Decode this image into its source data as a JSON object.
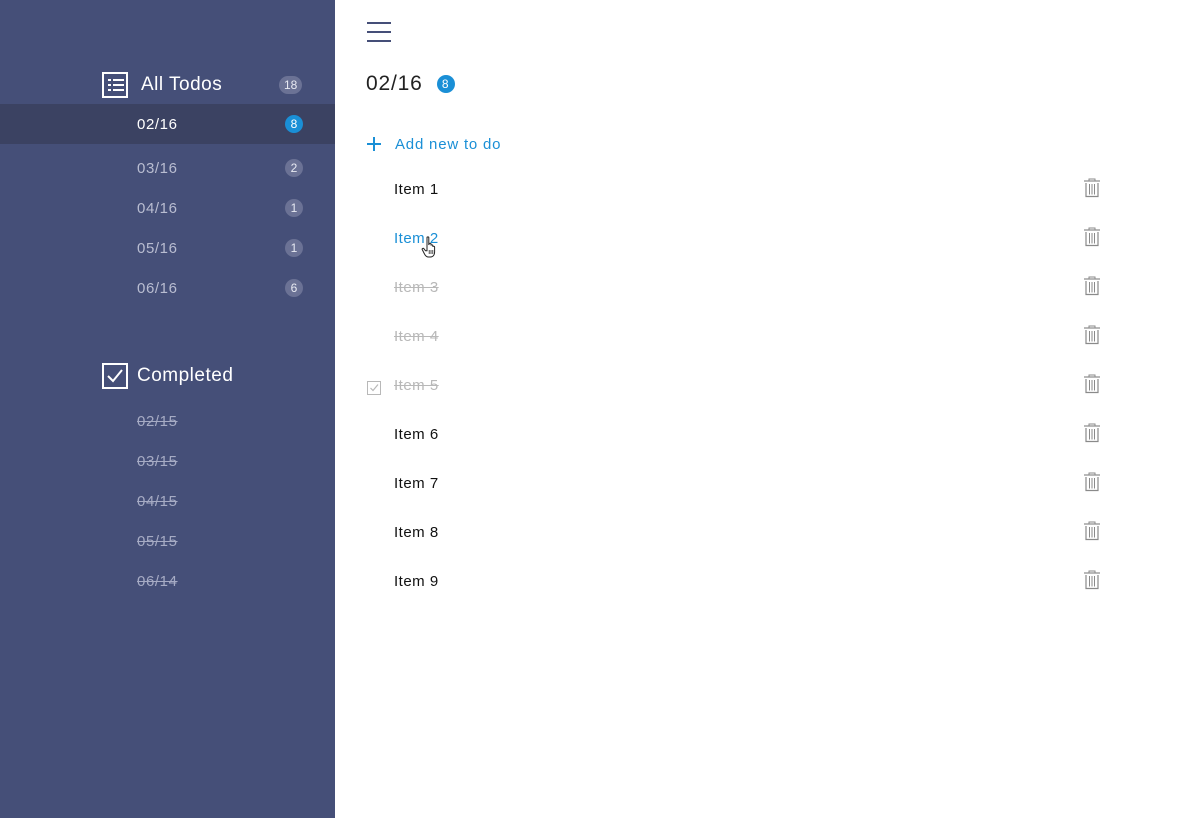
{
  "sidebar": {
    "todos_header": {
      "label": "All Todos",
      "count": "18",
      "icon": "list-icon"
    },
    "todo_dates": [
      {
        "date": "02/16",
        "count": "8",
        "selected": true
      },
      {
        "date": "03/16",
        "count": "2"
      },
      {
        "date": "04/16",
        "count": "1"
      },
      {
        "date": "05/16",
        "count": "1"
      },
      {
        "date": "06/16",
        "count": "6"
      }
    ],
    "completed_header": {
      "label": "Completed",
      "icon": "checkbox-checked-icon"
    },
    "completed_dates": [
      {
        "date": "02/15"
      },
      {
        "date": "03/15"
      },
      {
        "date": "04/15"
      },
      {
        "date": "05/15"
      },
      {
        "date": "06/14"
      }
    ]
  },
  "main": {
    "menu_icon": "hamburger-menu-icon",
    "title": "02/16",
    "title_count": "8",
    "add_label": "Add new to do",
    "items": [
      {
        "text": "Item 1",
        "done": false
      },
      {
        "text": "Item 2",
        "done": false,
        "hovered": true
      },
      {
        "text": "Item 3",
        "done": true
      },
      {
        "text": "Item 4",
        "done": true
      },
      {
        "text": "Item 5",
        "done": true,
        "checkbox_visible": true
      },
      {
        "text": "Item 6",
        "done": false
      },
      {
        "text": "Item 7",
        "done": false
      },
      {
        "text": "Item 8",
        "done": false
      },
      {
        "text": "Item 9",
        "done": false
      }
    ]
  },
  "colors": {
    "sidebar_bg": "#454f78",
    "sidebar_selected_bg": "#3b4262",
    "accent": "#1a8fd6",
    "badge_bg": "#6b7295",
    "done_text": "#b8b8b8"
  }
}
